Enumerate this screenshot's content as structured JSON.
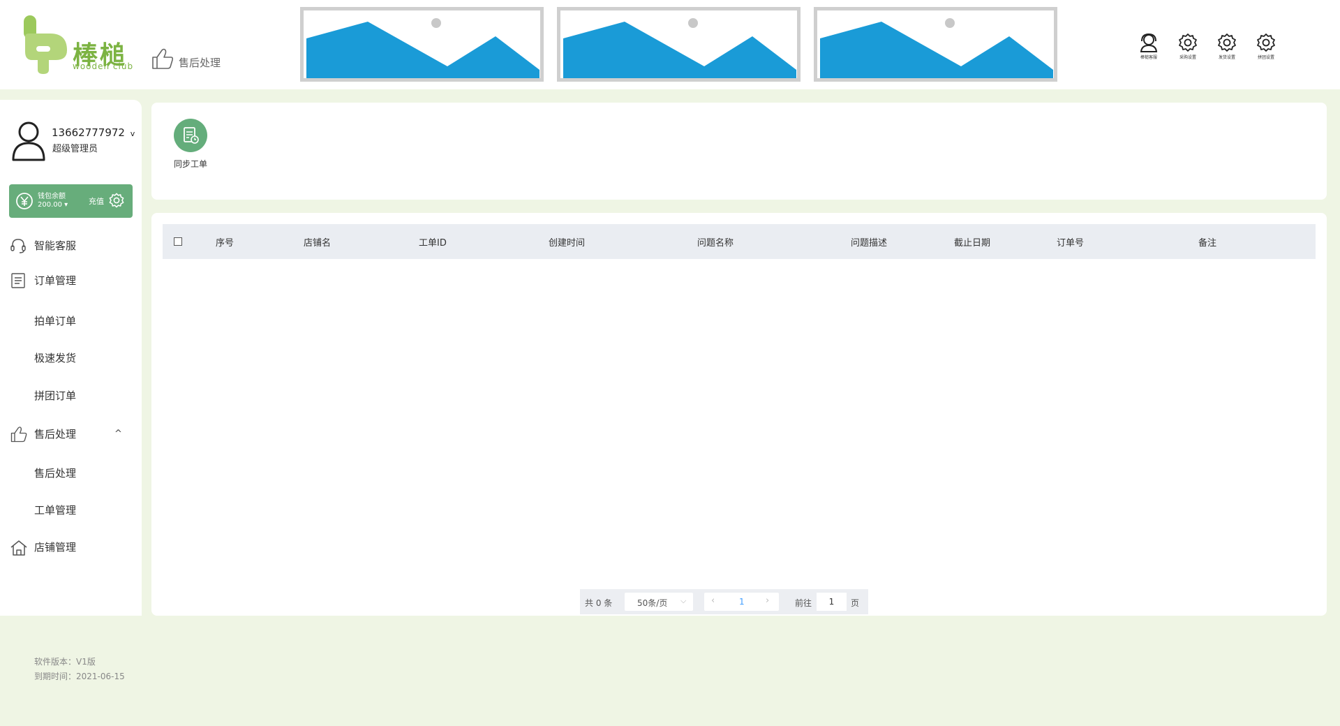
{
  "logo": {
    "cn": "棒槌",
    "en": "wooden club",
    "color": "#7cb342"
  },
  "header": {
    "current_page": "售后处理",
    "actions": [
      {
        "label": "棒槌客服",
        "icon": "customer-service-icon"
      },
      {
        "label": "采购设置",
        "icon": "gear-icon"
      },
      {
        "label": "发货设置",
        "icon": "gear-icon"
      },
      {
        "label": "拼团设置",
        "icon": "gear-icon"
      }
    ]
  },
  "user": {
    "phone": "13662777972",
    "dropdown_caret": "v",
    "role": "超级管理员"
  },
  "wallet": {
    "label": "钱包余额",
    "value": "200.00",
    "recharge": "充值",
    "color": "#67ad7b"
  },
  "nav": {
    "items": [
      {
        "label": "智能客服",
        "icon": "headset-icon"
      },
      {
        "label": "订单管理",
        "icon": "document-icon"
      },
      {
        "label": "拍单订单"
      },
      {
        "label": "极速发货"
      },
      {
        "label": "拼团订单"
      },
      {
        "label": "售后处理",
        "icon": "thumbs-up-icon",
        "caret": "^"
      },
      {
        "label": "售后处理"
      },
      {
        "label": "工单管理"
      },
      {
        "label": "店铺管理",
        "icon": "home-icon"
      }
    ]
  },
  "toolbar": {
    "sync_label": "同步工单"
  },
  "table": {
    "columns": [
      "序号",
      "店铺名",
      "工单ID",
      "创建时间",
      "问题名称",
      "问题描述",
      "截止日期",
      "订单号",
      "备注"
    ],
    "rows": []
  },
  "pagination": {
    "total": "共 0 条",
    "page_size": "50条/页",
    "current_page": "1",
    "goto_label": "前往",
    "goto_value": "1",
    "page_suffix": "页",
    "active_color": "#409eff"
  },
  "footer": {
    "version": "软件版本：V1版",
    "expiry": "到期时间：2021-06-15"
  }
}
